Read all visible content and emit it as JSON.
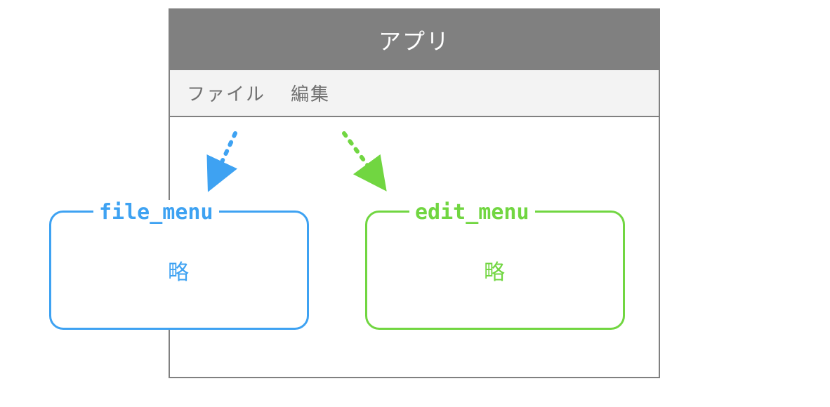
{
  "window": {
    "title": "アプリ",
    "menubar": {
      "file_label": "ファイル",
      "edit_label": "編集"
    }
  },
  "file_menu": {
    "legend": "file_menu",
    "content": "略"
  },
  "edit_menu": {
    "legend": "edit_menu",
    "content": "略"
  },
  "colors": {
    "file": "#3ea2f2",
    "edit": "#71d641"
  }
}
